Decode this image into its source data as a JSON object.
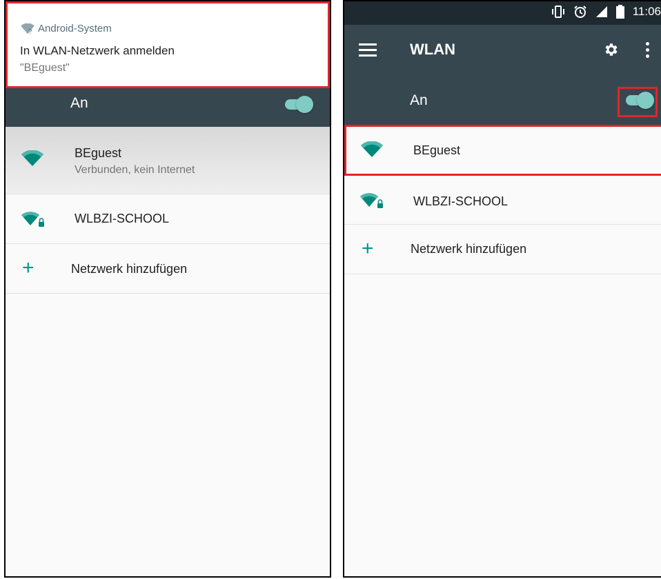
{
  "left": {
    "notification": {
      "app": "Android-System",
      "title": "In WLAN-Netzwerk anmelden",
      "text": "\"BEguest\""
    },
    "master_switch": {
      "label": "An",
      "on": true
    },
    "networks": [
      {
        "name": "BEguest",
        "status": "Verbunden, kein Internet",
        "secured": false,
        "signal": "full"
      },
      {
        "name": "WLBZI-SCHOOL",
        "secured": true,
        "signal": "full"
      }
    ],
    "add_network": "Netzwerk hinzufügen"
  },
  "right": {
    "status_bar": {
      "time": "11:06",
      "icons": [
        "vibrate-icon",
        "alarm-icon",
        "signal-icon",
        "battery-icon"
      ]
    },
    "toolbar": {
      "title": "WLAN",
      "icons": [
        "menu-icon",
        "settings-gear-icon",
        "overflow-menu-icon"
      ]
    },
    "master_switch": {
      "label": "An",
      "on": true
    },
    "networks": [
      {
        "name": "BEguest",
        "secured": false,
        "signal": "full"
      },
      {
        "name": "WLBZI-SCHOOL",
        "secured": true,
        "signal": "full"
      }
    ],
    "add_network": "Netzwerk hinzufügen"
  },
  "colors": {
    "toolbar": "#37474f",
    "status_bar": "#1f2a30",
    "accent": "#009688",
    "switch": "#80cbc4",
    "highlight": "#e0262c"
  }
}
